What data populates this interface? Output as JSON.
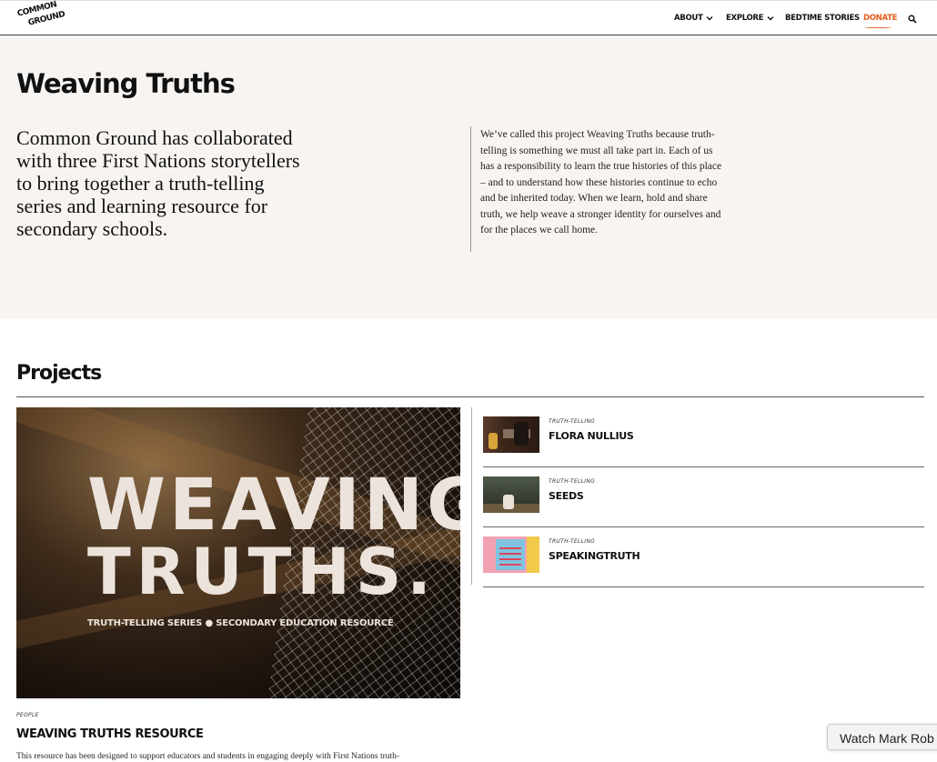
{
  "header": {
    "logo_line1": "COMMON",
    "logo_line2": "GROUND",
    "nav": {
      "about": "ABOUT",
      "explore": "EXPLORE",
      "bedtime": "BEDTIME STORIES",
      "donate": "DONATE"
    },
    "icons": {
      "search": "search-icon",
      "dropdown": "chevron-down-icon"
    },
    "accent_color": "#e25b1b"
  },
  "hero": {
    "title": "Weaving Truths",
    "lead": "Common Ground has collaborated with three First Nations storytellers to bring together a truth-telling series and learning resource for secondary schools.",
    "blurb": "We’ve called this project Weaving Truths because truth-telling is something we must all take part in. Each of us has a responsibility to learn the true histories of this place – and to understand how these histories continue to echo and be inherited today. When we learn, hold and share truth, we help weave a stronger identity for ourselves and for the places we call home."
  },
  "projects": {
    "heading": "Projects",
    "featured": {
      "image_line1": "WEAVING",
      "image_line2": "TRUTHS.",
      "image_sub": "TRUTH-TELLING SERIES  ●  SECONDARY EDUCATION RESOURCE",
      "category": "PEOPLE",
      "title": "WEAVING TRUTHS RESOURCE",
      "description": "This resource has been designed to support educators and students in engaging deeply with First Nations truth-"
    },
    "items": [
      {
        "category": "TRUTH-TELLING",
        "title": "FLORA NULLIUS"
      },
      {
        "category": "TRUTH-TELLING",
        "title": "SEEDS"
      },
      {
        "category": "TRUTH-TELLING",
        "title": "SPEAKINGTRUTH"
      }
    ]
  },
  "toast": {
    "label": "Watch Mark Rob"
  }
}
